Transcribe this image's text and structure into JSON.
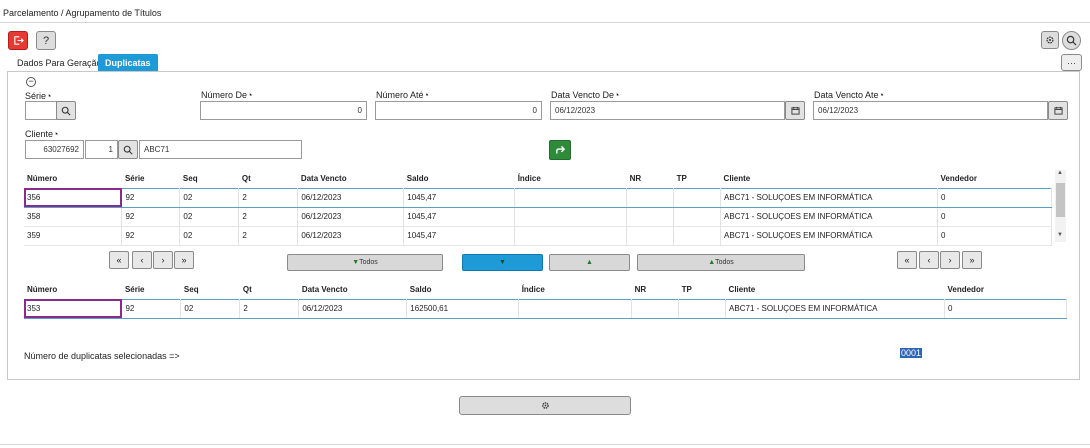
{
  "page_title": "Parcelamento / Agrupamento de Títulos",
  "toolbar": {
    "help_label": "?",
    "more_label": "···"
  },
  "tabs": [
    {
      "label": "Dados Para Geração"
    },
    {
      "label": "Duplicatas"
    }
  ],
  "filters": {
    "serie_label": "Série",
    "serie_value": "",
    "numero_de_label": "Número De",
    "numero_de_value": "0",
    "numero_ate_label": "Número Até",
    "numero_ate_value": "0",
    "data_vencto_de_label": "Data Vencto De",
    "data_vencto_de_value": "06/12/2023",
    "data_vencto_ate_label": "Data Vencto Ate",
    "data_vencto_ate_value": "06/12/2023",
    "cliente_label": "Cliente",
    "cliente_code": "63027692",
    "cliente_seq": "1",
    "cliente_name": "ABC71"
  },
  "columns": [
    "Número",
    "Série",
    "Seq",
    "Qt",
    "Data Vencto",
    "Saldo",
    "Índice",
    "NR",
    "TP",
    "Cliente",
    "Vendedor"
  ],
  "top_rows": [
    [
      "356",
      "92",
      "02",
      "2",
      "06/12/2023",
      "1045,47",
      "",
      "",
      "",
      "ABC71 - SOLUÇOES EM INFORMÁTICA",
      "0"
    ],
    [
      "358",
      "92",
      "02",
      "2",
      "06/12/2023",
      "1045,47",
      "",
      "",
      "",
      "ABC71 - SOLUÇOES EM INFORMÁTICA",
      "0"
    ],
    [
      "359",
      "92",
      "02",
      "2",
      "06/12/2023",
      "1045,47",
      "",
      "",
      "",
      "ABC71 - SOLUÇOES EM INFORMÁTICA",
      "0"
    ]
  ],
  "bottom_rows": [
    [
      "353",
      "92",
      "02",
      "2",
      "06/12/2023",
      "162500,61",
      "",
      "",
      "",
      "ABC71 - SOLUÇOES EM INFORMÁTICA",
      "0"
    ]
  ],
  "nav": {
    "first": "«",
    "prev": "‹",
    "next": "›",
    "last": "»"
  },
  "transfer": {
    "add_all": "Todos",
    "remove_all": "Todos"
  },
  "summary": {
    "label": "Número de duplicatas selecionadas =>",
    "value": "0001"
  }
}
